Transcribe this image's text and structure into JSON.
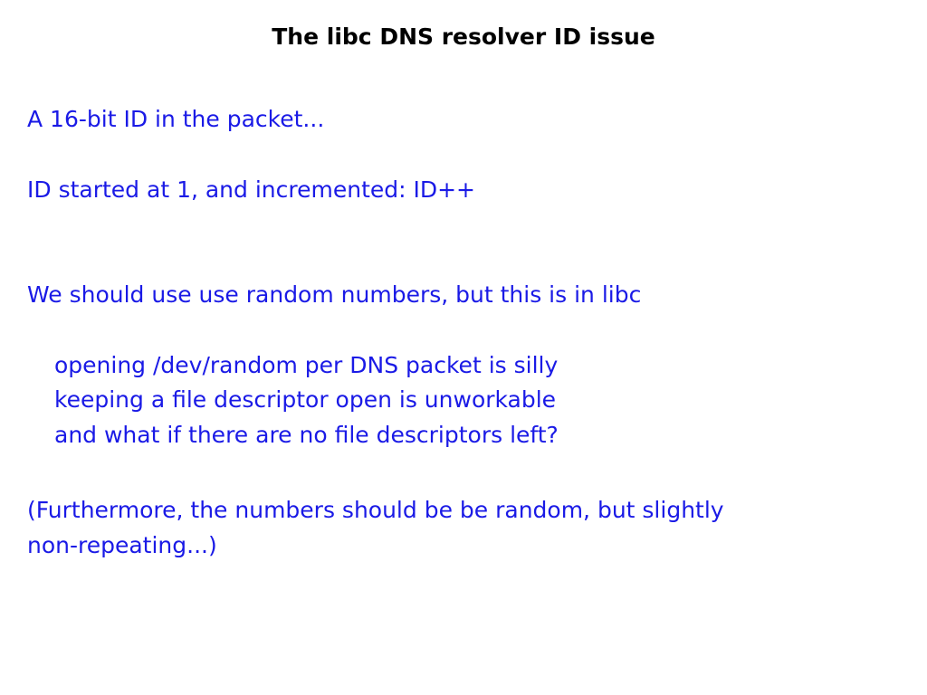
{
  "title": "The libc DNS resolver ID issue",
  "lines": [
    "A 16-bit ID in the packet...",
    "ID started at 1, and incremented: ID++",
    "We should use use random numbers, but this is in libc",
    "opening /dev/random per DNS packet is silly",
    "keeping a file descriptor open is unworkable",
    "and what if there are no file descriptors left?",
    "(Furthermore, the numbers should be be random, but slightly",
    "non-repeating...)"
  ],
  "colors": {
    "title": "#000000",
    "body": "#1a1ae6",
    "background": "#ffffff"
  }
}
